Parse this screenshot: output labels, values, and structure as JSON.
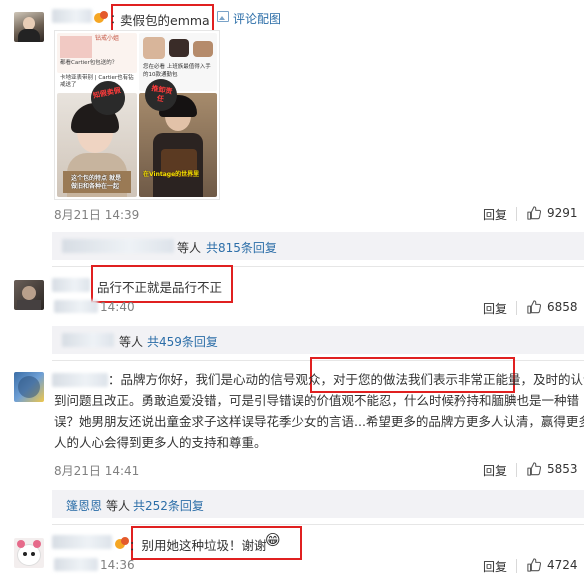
{
  "comments": [
    {
      "username_suffix": "卖假包的emma",
      "colon": "：",
      "image_link": "评论配图",
      "images": {
        "top_left_lines": [
          "钻戒小姐",
          "都看Cartier包包送的？"
        ],
        "top_left_caption": "卡地亚表带别 | Cartier也有钻戒送了",
        "top_right_lines": [
          "您在必看 上班族最值得入手的10款通勤包"
        ],
        "sticker_left": "知假卖假",
        "sticker_right": "推卸责任",
        "bottom_left_caption": "这个包的特点 就是做旧和各种在一起",
        "bottom_right_caption": "在Vintage的世界里"
      },
      "time": "8月21日 14:39",
      "reply": "回复",
      "likes": "9291",
      "sub": {
        "suffix": "等人",
        "count_link": "共815条回复"
      }
    },
    {
      "text": "品行不正就是品行不正",
      "time": "14:40",
      "reply": "回复",
      "likes": "6858",
      "sub": {
        "suffix": "等人",
        "count_link": "共459条回复"
      }
    },
    {
      "text_lines": [
        "：品牌方你好，我们是心动的信号观众，对于您的做法我们表示非常正能量，及时的认识",
        "到问题且改正。勇敢追爱没错，可是引导错误的价值观不能忍，什么时候矜持和腼腆也是一种错",
        "误？她男朋友还说出童金求子这样误导花季少女的言语...希望更多的品牌方更多人认清，赢得更多",
        "人的人心会得到更多人的支持和尊重。"
      ],
      "time": "8月21日 14:41",
      "reply": "回复",
      "likes": "5853",
      "sub": {
        "prefix": "篷恩恩",
        "suffix": "等人",
        "count_link": "共252条回复"
      }
    },
    {
      "text": "：别用她这种垃圾！谢谢",
      "emoji": "😁",
      "time": "14:36",
      "reply": "回复",
      "likes": "4724"
    }
  ],
  "colors": {
    "link": "#2c6ea8",
    "highlight": "#e02020",
    "meta": "#808080"
  }
}
